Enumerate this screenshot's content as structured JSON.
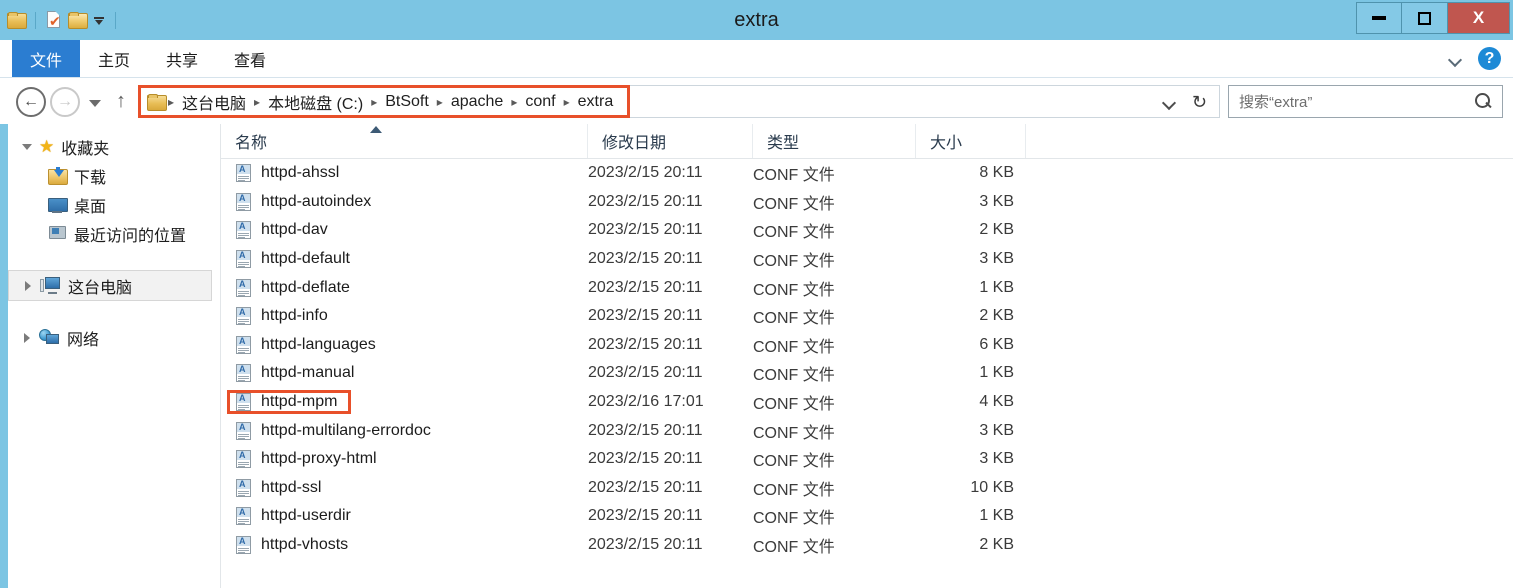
{
  "window": {
    "title": "extra",
    "titlebar_color": "#7cc5e3",
    "accent_color": "#2b7dd1",
    "highlight_color": "#e8502a"
  },
  "quick_access": {
    "system_menu_icon": "folder-icon",
    "properties_icon": "properties-doc-check-icon",
    "new_folder_icon": "new-folder-icon",
    "customize_icon": "customize-qat-caret-icon"
  },
  "window_controls": {
    "minimize": "—",
    "maximize": "□",
    "close": "X"
  },
  "ribbon": {
    "tabs": [
      {
        "label": "文件",
        "active": true
      },
      {
        "label": "主页",
        "active": false
      },
      {
        "label": "共享",
        "active": false
      },
      {
        "label": "查看",
        "active": false
      }
    ],
    "collapse_icon": "chevron-down-icon",
    "help_icon": "help-icon",
    "help_glyph": "?"
  },
  "address_bar": {
    "back_glyph": "←",
    "forward_glyph": "→",
    "recent_icon": "recent-locations-caret-icon",
    "up_glyph": "↑",
    "folder_icon": "folder-icon",
    "breadcrumbs": [
      "这台电脑",
      "本地磁盘 (C:)",
      "BtSoft",
      "apache",
      "conf",
      "extra"
    ],
    "separator": "▸",
    "history_icon": "history-chevron-icon",
    "refresh_glyph": "↻",
    "highlighted": true
  },
  "search": {
    "placeholder": "搜索“extra”",
    "value": "",
    "icon": "search-icon"
  },
  "sidebar": {
    "items": [
      {
        "label": "收藏夹",
        "icon": "star-icon",
        "expander": "down",
        "indent": false,
        "selected": false
      },
      {
        "label": "下载",
        "icon": "downloads-folder-icon",
        "expander": "none",
        "indent": true,
        "selected": false
      },
      {
        "label": "桌面",
        "icon": "desktop-icon",
        "expander": "none",
        "indent": true,
        "selected": false
      },
      {
        "label": "最近访问的位置",
        "icon": "recent-places-icon",
        "expander": "none",
        "indent": true,
        "selected": false
      },
      {
        "label": "这台电脑",
        "icon": "this-pc-icon",
        "expander": "right",
        "indent": false,
        "selected": true
      },
      {
        "label": "网络",
        "icon": "network-icon",
        "expander": "right",
        "indent": false,
        "selected": false
      }
    ]
  },
  "file_list": {
    "columns": [
      {
        "label": "名称",
        "sorted": "asc"
      },
      {
        "label": "修改日期",
        "sorted": "none"
      },
      {
        "label": "类型",
        "sorted": "none"
      },
      {
        "label": "大小",
        "sorted": "none"
      }
    ],
    "rows": [
      {
        "name": "httpd-ahssl",
        "date": "2023/2/15 20:11",
        "type": "CONF 文件",
        "size": "8 KB",
        "highlighted": false
      },
      {
        "name": "httpd-autoindex",
        "date": "2023/2/15 20:11",
        "type": "CONF 文件",
        "size": "3 KB",
        "highlighted": false
      },
      {
        "name": "httpd-dav",
        "date": "2023/2/15 20:11",
        "type": "CONF 文件",
        "size": "2 KB",
        "highlighted": false
      },
      {
        "name": "httpd-default",
        "date": "2023/2/15 20:11",
        "type": "CONF 文件",
        "size": "3 KB",
        "highlighted": false
      },
      {
        "name": "httpd-deflate",
        "date": "2023/2/15 20:11",
        "type": "CONF 文件",
        "size": "1 KB",
        "highlighted": false
      },
      {
        "name": "httpd-info",
        "date": "2023/2/15 20:11",
        "type": "CONF 文件",
        "size": "2 KB",
        "highlighted": false
      },
      {
        "name": "httpd-languages",
        "date": "2023/2/15 20:11",
        "type": "CONF 文件",
        "size": "6 KB",
        "highlighted": false
      },
      {
        "name": "httpd-manual",
        "date": "2023/2/15 20:11",
        "type": "CONF 文件",
        "size": "1 KB",
        "highlighted": false
      },
      {
        "name": "httpd-mpm",
        "date": "2023/2/16 17:01",
        "type": "CONF 文件",
        "size": "4 KB",
        "highlighted": true
      },
      {
        "name": "httpd-multilang-errordoc",
        "date": "2023/2/15 20:11",
        "type": "CONF 文件",
        "size": "3 KB",
        "highlighted": false
      },
      {
        "name": "httpd-proxy-html",
        "date": "2023/2/15 20:11",
        "type": "CONF 文件",
        "size": "3 KB",
        "highlighted": false
      },
      {
        "name": "httpd-ssl",
        "date": "2023/2/15 20:11",
        "type": "CONF 文件",
        "size": "10 KB",
        "highlighted": false
      },
      {
        "name": "httpd-userdir",
        "date": "2023/2/15 20:11",
        "type": "CONF 文件",
        "size": "1 KB",
        "highlighted": false
      },
      {
        "name": "httpd-vhosts",
        "date": "2023/2/15 20:11",
        "type": "CONF 文件",
        "size": "2 KB",
        "highlighted": false
      }
    ],
    "file_icon": "conf-file-icon",
    "file_icon_glyph": "A"
  }
}
